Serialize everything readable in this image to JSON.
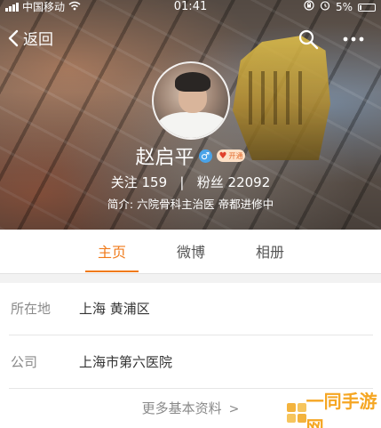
{
  "status_bar": {
    "carrier": "中国移动",
    "time": "01:41",
    "battery": "5%"
  },
  "nav": {
    "back_label": "返回"
  },
  "profile": {
    "name": "赵启平",
    "gender_symbol": "♂",
    "vip_badge": "开通",
    "stats": "关注 159   |   粉丝 22092",
    "bio": "简介: 六院骨科主治医 帝都进修中"
  },
  "tabs": [
    {
      "label": "主页",
      "active": true
    },
    {
      "label": "微博",
      "active": false
    },
    {
      "label": "相册",
      "active": false
    }
  ],
  "info": {
    "rows": [
      {
        "label": "所在地",
        "value": "上海 黄浦区"
      },
      {
        "label": "公司",
        "value": "上海市第六医院"
      }
    ],
    "more_label": "更多基本资料"
  },
  "watermark": {
    "text": "一同手游网"
  },
  "colors": {
    "accent": "#f07a1a",
    "gender_badge": "#4aa3e8",
    "watermark": "#f5a623"
  },
  "icons": {
    "back": "chevron-left-icon",
    "search": "search-icon",
    "more": "more-dots-icon",
    "wifi": "wifi-icon",
    "lock": "lock-icon",
    "alarm": "alarm-icon",
    "battery": "battery-icon",
    "chevron": "chevron-right-icon"
  }
}
